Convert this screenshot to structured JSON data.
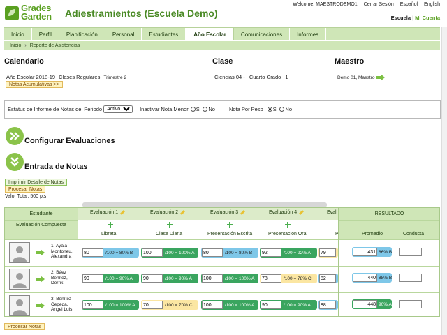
{
  "app": {
    "logo_text_1": "Grades",
    "logo_text_2": "Garden",
    "title": "Adiestramientos (Escuela Demo)"
  },
  "topbar": {
    "welcome": "Welcome: MAESTRODEMO1",
    "logout": "Cerrar Sesión",
    "lang_es": "Español",
    "lang_en": "English"
  },
  "switcher": {
    "current": "Escuela",
    "separator": "|",
    "other": "Mi Cuenta"
  },
  "nav": {
    "tabs": [
      "Inicio",
      "Perfil",
      "Planificación",
      "Personal",
      "Estudiantes",
      "Año Escolar",
      "Comunicaciones",
      "Informes"
    ],
    "active_tab": "Año Escolar"
  },
  "breadcrumb": {
    "home": "Inicio",
    "sep": "›",
    "current": "Reporte de Asistencias"
  },
  "calendar": {
    "heading": "Calendario",
    "school_year": "Año Escolar 2018-19",
    "classes": "Clases Regulares",
    "term": "Trimestre 2",
    "notes_button": "Notas Acumulativas >>"
  },
  "class": {
    "heading": "Clase",
    "name": "Ciencias 04 -",
    "grade": "Cuarto Grado",
    "section": "1"
  },
  "teacher": {
    "heading": "Maestro",
    "name": "Demo 01, Maestro"
  },
  "status_bar": {
    "report_label": "Estatus de Informe de Notas del Periodo",
    "report_value": "Activo",
    "inactivate_label": "Inactivar Nota Menor",
    "weight_label": "Nota Por Peso",
    "yes": "Si",
    "no": "No",
    "inactivate_selected": "none",
    "weight_selected": "Si"
  },
  "sections": {
    "configure": "Configurar Evaluaciones",
    "entry": "Entrada de Notas"
  },
  "actions": {
    "print": "Imprimir Detalle de Notas",
    "process": "Procesar Notas",
    "total": "Valor Total: 500 pts",
    "process_bottom": "Procesar Notas"
  },
  "grid": {
    "student_header": "Estudiante",
    "composite_header": "Evaluación Compuesta",
    "result_header": "RESULTADO",
    "evaluations": [
      {
        "name": "Evaluación 1",
        "sub": "Libreta"
      },
      {
        "name": "Evaluación 2",
        "sub": "Clase Diaria"
      },
      {
        "name": "Evaluación 3",
        "sub": "Presentación Escrita"
      },
      {
        "name": "Evaluación 4",
        "sub": "Presentación Oral"
      },
      {
        "name": "Eval",
        "sub": "P"
      }
    ],
    "result_cols": {
      "average": "Promedio",
      "conduct": "Conducta"
    },
    "students": [
      {
        "name": "1. Ayala\nMontoneu,\nAlexandra",
        "scores": [
          {
            "value": "80",
            "text": "/100 = 80% B",
            "color": "blue"
          },
          {
            "value": "100",
            "text": "/100 = 100% A",
            "color": "green"
          },
          {
            "value": "80",
            "text": "/100 = 80% B",
            "color": "blue"
          },
          {
            "value": "92",
            "text": "/100 = 92% A",
            "color": "green"
          },
          {
            "value": "79",
            "text": "",
            "color": "yellow"
          }
        ],
        "total": "431",
        "average": "86% B",
        "average_color": "blue"
      },
      {
        "name": "2. Báez\nBenítez,\nDerrik",
        "scores": [
          {
            "value": "90",
            "text": "/100 = 90% A",
            "color": "green"
          },
          {
            "value": "90",
            "text": "/100 = 90% A",
            "color": "green"
          },
          {
            "value": "100",
            "text": "/100 = 100% A",
            "color": "green"
          },
          {
            "value": "78",
            "text": "/100 = 78% C",
            "color": "yellow"
          },
          {
            "value": "82",
            "text": "",
            "color": "blue"
          }
        ],
        "total": "440",
        "average": "88% B",
        "average_color": "blue"
      },
      {
        "name": "3. Benítez\nCepeda,\nAngel Luis",
        "scores": [
          {
            "value": "100",
            "text": "/100 = 100% A",
            "color": "green"
          },
          {
            "value": "70",
            "text": "/100 = 70% C",
            "color": "yellow"
          },
          {
            "value": "100",
            "text": "/100 = 100% A",
            "color": "green"
          },
          {
            "value": "90",
            "text": "/100 = 90% A",
            "color": "green"
          },
          {
            "value": "88",
            "text": "",
            "color": "blue"
          }
        ],
        "total": "448",
        "average": "90% A",
        "average_color": "green"
      }
    ]
  }
}
